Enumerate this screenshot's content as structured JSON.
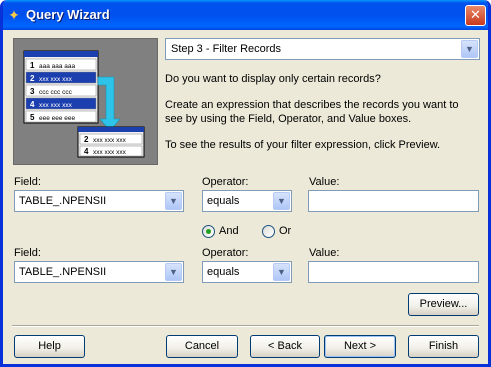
{
  "window": {
    "title": "Query Wizard"
  },
  "step": {
    "selected": "Step 3 - Filter Records"
  },
  "instructions": {
    "question": "Do you want to display only certain records?",
    "description_line1": "Create an expression that describes the records you want to",
    "description_line2": "see by using the Field, Operator, and Value boxes.",
    "preview_hint": "To see the results of your filter expression, click Preview."
  },
  "illustration": {
    "table_rows": [
      {
        "num": "1",
        "text": "aaa aaa aaa"
      },
      {
        "num": "2",
        "text": "xxx xxx xxx"
      },
      {
        "num": "3",
        "text": "ccc ccc ccc"
      },
      {
        "num": "4",
        "text": "xxx xxx xxx"
      },
      {
        "num": "5",
        "text": "eee eee eee"
      }
    ],
    "result_rows": [
      {
        "num": "2",
        "text": "xxx xxx xxx"
      },
      {
        "num": "4",
        "text": "xxx xxx xxx"
      }
    ]
  },
  "criteria1": {
    "field_label": "Field:",
    "field_value": "TABLE_.NPENSII",
    "operator_label": "Operator:",
    "operator_value": "equals",
    "value_label": "Value:",
    "value_value": ""
  },
  "logic": {
    "and_label": "And",
    "or_label": "Or",
    "selected": "And"
  },
  "criteria2": {
    "field_label": "Field:",
    "field_value": "TABLE_.NPENSII",
    "operator_label": "Operator:",
    "operator_value": "equals",
    "value_label": "Value:",
    "value_value": ""
  },
  "buttons": {
    "preview": "Preview...",
    "help": "Help",
    "cancel": "Cancel",
    "back": "< Back",
    "next": "Next >",
    "finish": "Finish"
  },
  "icons": {
    "title": "query-wizard-app-icon",
    "close": "close-icon",
    "dropdown": "chevron-down-icon"
  },
  "colors": {
    "titlebar": "#0053ee",
    "window_bg": "#ece9d8",
    "illustration_bg": "#808080",
    "highlight_rows": "#1c3fb0",
    "arrow": "#2ec3e8"
  }
}
